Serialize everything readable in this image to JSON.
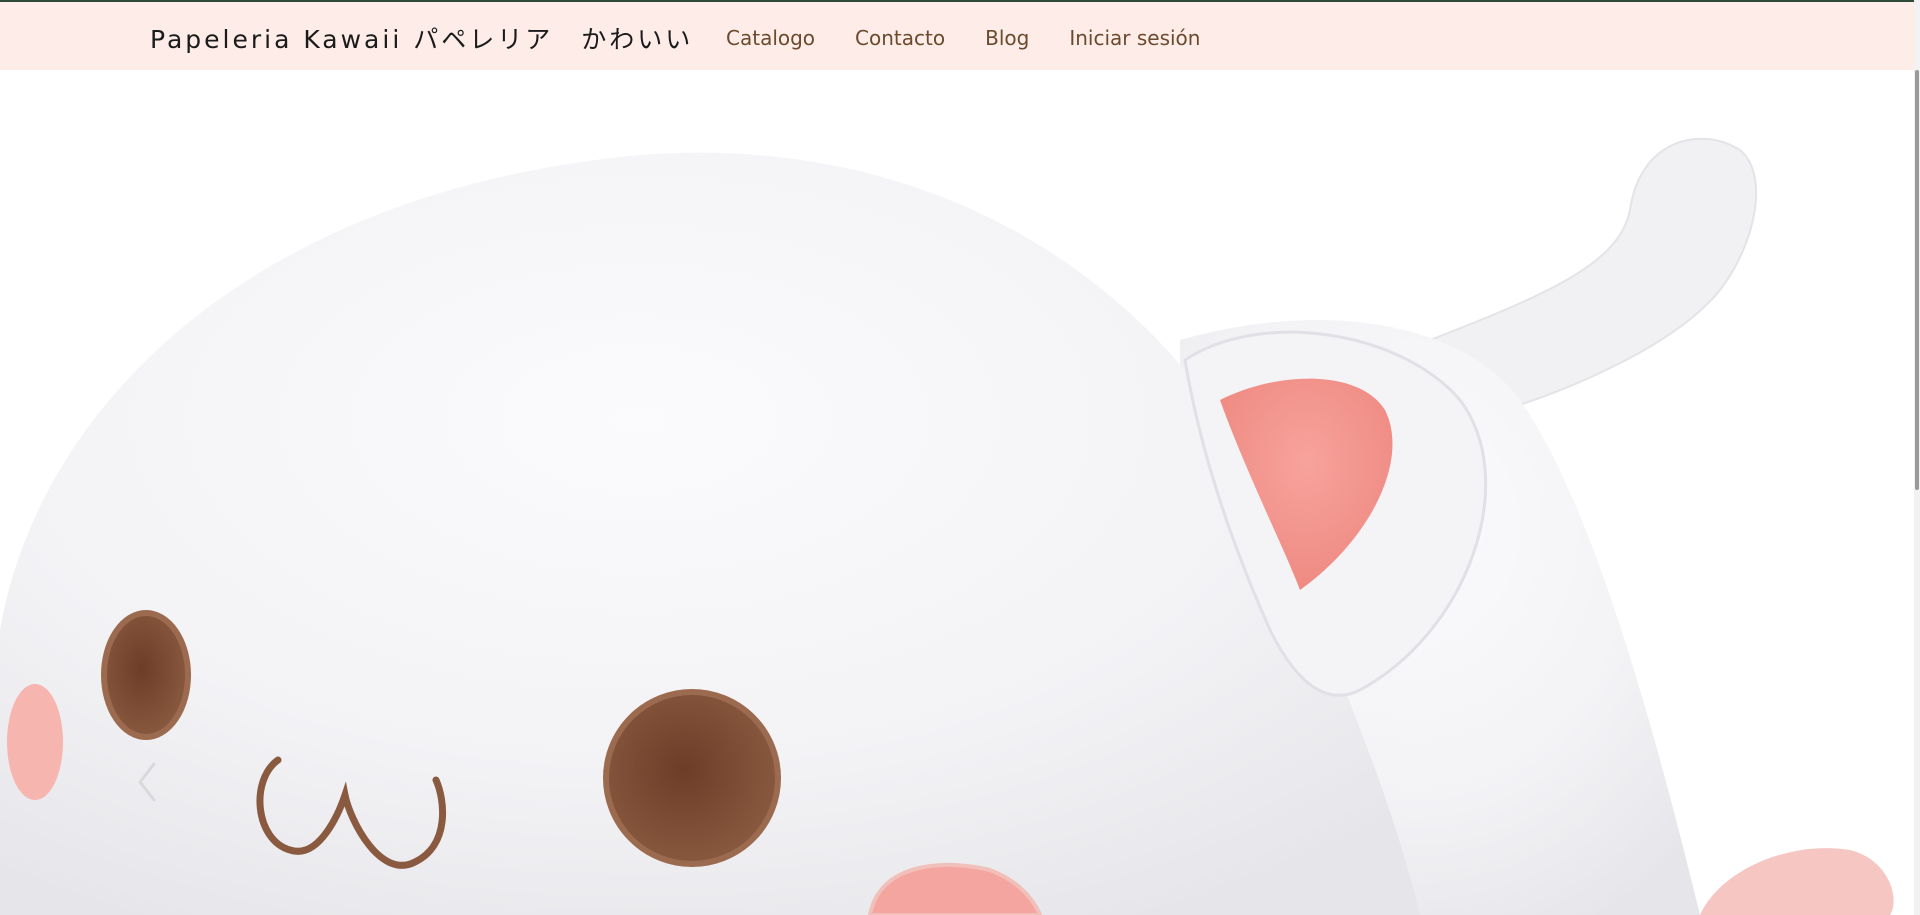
{
  "header": {
    "brand": "Papeleria Kawaii パペレリア　かわいい",
    "nav": [
      {
        "label": "Catalogo"
      },
      {
        "label": "Contacto"
      },
      {
        "label": "Blog"
      },
      {
        "label": "Iniciar sesión"
      }
    ]
  },
  "hero": {
    "image_subject": "white-cat-plush",
    "prev_icon": "chevron-left-icon"
  },
  "colors": {
    "header_bg": "#fdece7",
    "header_border": "#2f4a38",
    "nav_text": "#6b4a2e",
    "brand_text": "#1b1b1b",
    "plush_body": "#f6f6f8",
    "plush_pink": "#f08f88",
    "plush_brown": "#7a4a32"
  }
}
